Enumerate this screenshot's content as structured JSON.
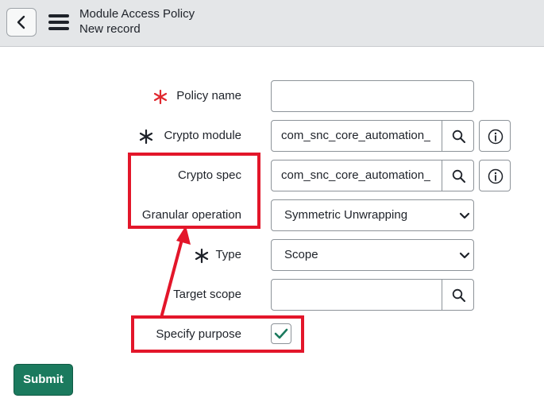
{
  "header": {
    "title": "Module Access Policy",
    "subtitle": "New record"
  },
  "form": {
    "policy_name": {
      "label": "Policy name",
      "value": "",
      "required": true,
      "required_color": "#e0282f"
    },
    "crypto_module": {
      "label": "Crypto module",
      "value": "com_snc_core_automation_",
      "required": true
    },
    "crypto_spec": {
      "label": "Crypto spec",
      "value": "com_snc_core_automation_"
    },
    "granular_operation": {
      "label": "Granular operation",
      "selected": "Symmetric Unwrapping"
    },
    "type": {
      "label": "Type",
      "selected": "Scope",
      "required": true
    },
    "target_scope": {
      "label": "Target scope",
      "value": ""
    },
    "specify_purpose": {
      "label": "Specify purpose",
      "checked": true
    }
  },
  "actions": {
    "submit_label": "Submit"
  },
  "colors": {
    "highlight": "#e3162a",
    "submit": "#1b7a5e",
    "header_bg": "#e4e6e8"
  }
}
